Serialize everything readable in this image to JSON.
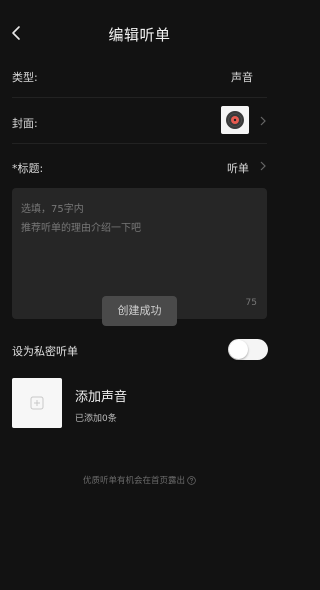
{
  "header": {
    "title": "编辑听单",
    "back_icon": "chevron-left-icon"
  },
  "rows": {
    "type": {
      "label": "类型:",
      "value": "声音"
    },
    "cover": {
      "label": "封面:",
      "thumb_icon": "record-disc-icon"
    },
    "title": {
      "label": "*标题:",
      "value": "听单"
    }
  },
  "description": {
    "placeholder_line1": "选填，75字内",
    "placeholder_line2": "推荐听单的理由介绍一下吧",
    "counter": "75"
  },
  "toast": {
    "text": "创建成功"
  },
  "privacy": {
    "label": "设为私密听单",
    "enabled": false
  },
  "add_sound": {
    "title": "添加声音",
    "subtitle": "已添加0条",
    "icon": "plus-icon"
  },
  "footer": {
    "text": "优质听单有机会在首页露出",
    "icon": "question-circle-icon"
  },
  "colors": {
    "background": "#121212",
    "panel": "#262626",
    "toast": "#4a4a4a",
    "accent_record": "#e85a4f"
  }
}
